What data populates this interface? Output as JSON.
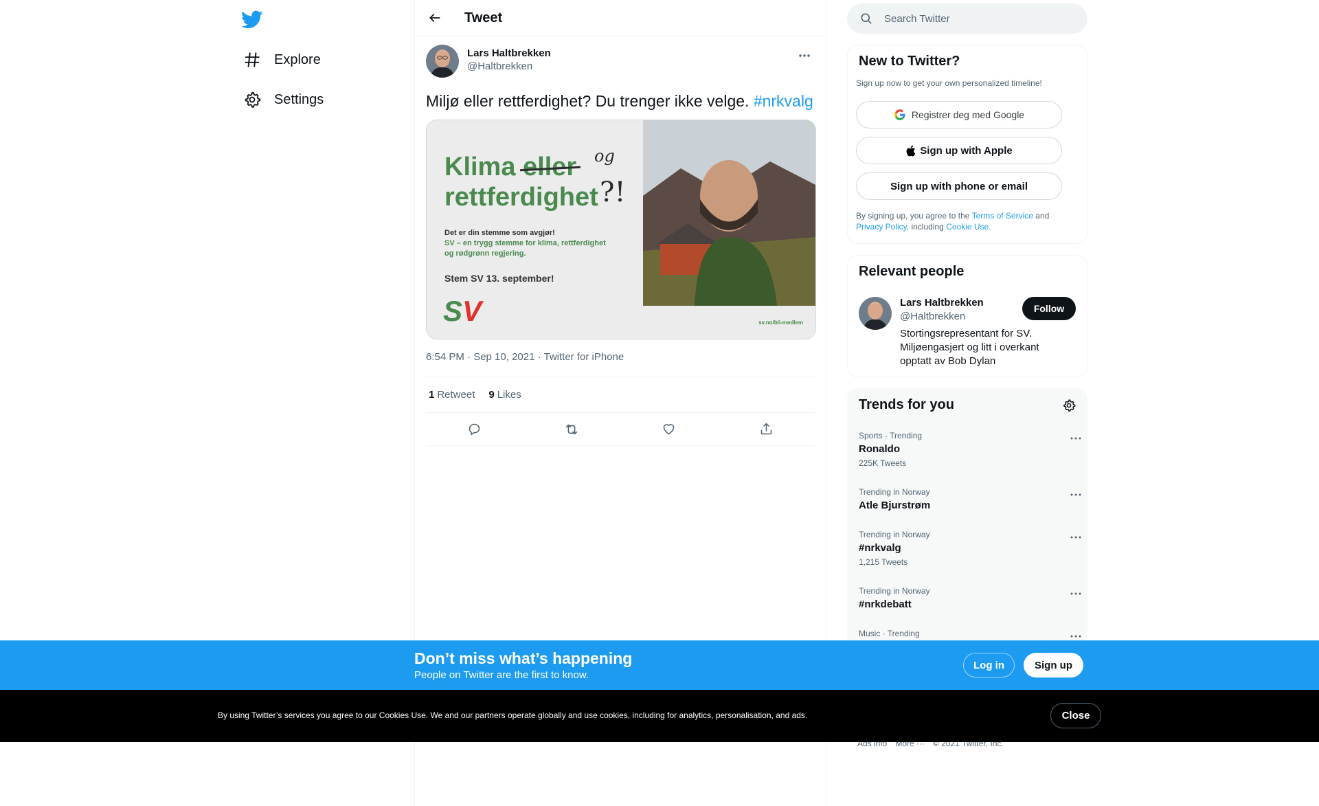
{
  "nav": {
    "logo_icon": "twitter-bird-icon",
    "items": [
      {
        "icon": "hashtag-icon",
        "label": "Explore"
      },
      {
        "icon": "gear-icon",
        "label": "Settings"
      }
    ]
  },
  "header": {
    "back_icon": "arrow-left-icon",
    "title": "Tweet"
  },
  "tweet": {
    "author": {
      "name": "Lars Haltbrekken",
      "handle": "@Haltbrekken"
    },
    "text": "Miljø eller rettferdighet? Du trenger ikke velge.",
    "hashtag": "#nrkvalg",
    "media": {
      "word1": "Klima",
      "struck": "eller",
      "scribble_og": "og",
      "word2": "rettferdighet",
      "scribble_mark": "?!",
      "line1": "Det er din stemme som avgjør!",
      "line2": "SV – en trygg stemme for klima, rettferdighet",
      "line3": "og rødgrønn regjering.",
      "cta": "Stem SV 13. september!",
      "logo": "SV",
      "url": "sv.no/bli-medlem"
    },
    "meta": "6:54 PM · Sep 10, 2021 · Twitter for iPhone",
    "stats": {
      "retweets": "1",
      "retweets_label": "Retweet",
      "likes": "9",
      "likes_label": "Likes"
    }
  },
  "search": {
    "placeholder": "Search Twitter"
  },
  "signup": {
    "title": "New to Twitter?",
    "subtitle": "Sign up now to get your own personalized timeline!",
    "google": "Registrer deg med Google",
    "apple": "Sign up with Apple",
    "phone": "Sign up with phone or email",
    "legal_prefix": "By signing up, you agree to the",
    "tos": "Terms of Service",
    "and": "and",
    "privacy": "Privacy Policy",
    "including": ", including",
    "cookie": "Cookie Use."
  },
  "relevant": {
    "title": "Relevant people",
    "person": {
      "name": "Lars Haltbrekken",
      "handle": "@Haltbrekken",
      "bio": "Stortingsrepresentant for SV. Miljøengasjert og litt i overkant opptatt av Bob Dylan",
      "follow": "Follow"
    }
  },
  "trends": {
    "title": "Trends for you",
    "items": [
      {
        "context": "Sports · Trending",
        "name": "Ronaldo",
        "count": "225K Tweets"
      },
      {
        "context": "Trending in Norway",
        "name": "Atle Bjurstrøm",
        "count": ""
      },
      {
        "context": "Trending in Norway",
        "name": "#nrkvalg",
        "count": "1,215 Tweets"
      },
      {
        "context": "Trending in Norway",
        "name": "#nrkdebatt",
        "count": ""
      },
      {
        "context": "Music · Trending",
        "name": "",
        "count": ""
      }
    ]
  },
  "footer": {
    "ads": "Ads info",
    "more": "More ···",
    "copyright": "© 2021 Twitter, Inc."
  },
  "bottombar": {
    "title": "Don’t miss what’s happening",
    "subtitle": "People on Twitter are the first to know.",
    "login": "Log in",
    "signup": "Sign up"
  },
  "cookies": {
    "text": "By using Twitter’s services you agree to our Cookies Use. We and our partners operate globally and use cookies, including for analytics, personalisation, and ads.",
    "close": "Close"
  },
  "colors": {
    "accent": "#1d9bf0",
    "text": "#0f1419",
    "muted": "#536471",
    "sv_green": "#4a8a4f",
    "sv_red": "#e1322c"
  }
}
